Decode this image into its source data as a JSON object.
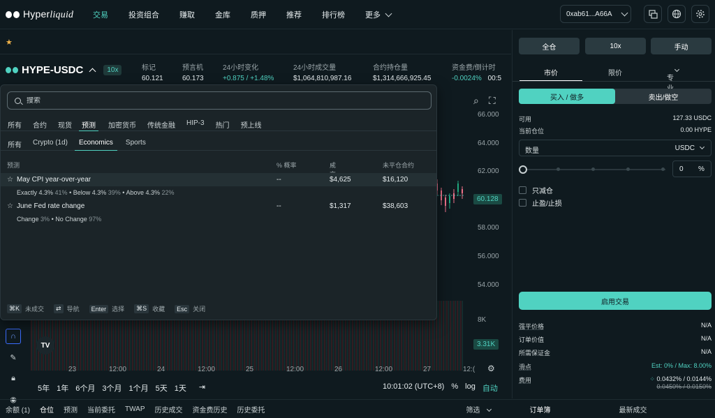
{
  "nav": {
    "brand": "Hyperliquid",
    "links": [
      "交易",
      "投资组合",
      "赚取",
      "金库",
      "质押",
      "推荐",
      "排行榜",
      "更多"
    ],
    "wallet": "0xab61...A66A"
  },
  "ticker": {
    "pair": "HYPE-USDC",
    "leverage": "10x",
    "stats": [
      {
        "label": "标记",
        "value": "60.121"
      },
      {
        "label": "预言机",
        "value": "60.173"
      },
      {
        "label": "24小时变化",
        "value": "+0.875 / +1.48%"
      },
      {
        "label": "24小时成交量",
        "value": "$1,064,810,987.16"
      },
      {
        "label": "合约持仓量",
        "value": "$1,314,666,925.45"
      },
      {
        "label": "资金费/倒计时",
        "value": "-0.0024%",
        "extra": "00:5"
      }
    ]
  },
  "chart": {
    "y_ticks": [
      "66.000",
      "64.000",
      "62.000",
      "60.128",
      "58.000",
      "56.000",
      "54.000",
      "8K",
      "3.31K"
    ],
    "x_ticks": [
      "23",
      "12:00",
      "24",
      "12:00",
      "25",
      "12:00",
      "26",
      "12:00",
      "27",
      "12:("
    ],
    "ranges": [
      "5年",
      "1年",
      "6个月",
      "3个月",
      "1个月",
      "5天",
      "1天"
    ],
    "time": "10:01:02 (UTC+8)",
    "pct": "%",
    "log": "log",
    "auto": "自动",
    "current_price": "60.128",
    "current_vol": "3.31K"
  },
  "dropdown": {
    "search_placeholder": "搜索",
    "tabs": [
      "所有",
      "合约",
      "现货",
      "预测",
      "加密货币",
      "传统金融",
      "HIP-3",
      "热门",
      "预上线"
    ],
    "subtabs": [
      "所有",
      "Crypto (1d)",
      "Economics",
      "Sports"
    ],
    "columns": {
      "name": "预测",
      "prob": "% 概率",
      "volume": "成交量",
      "oi": "未平仓合约"
    },
    "rows": [
      {
        "title": "May CPI year-over-year",
        "prob": "--",
        "volume": "$4,625",
        "oi": "$16,120",
        "outcomes": [
          {
            "label": "Exactly 4.3%",
            "pct": "41%"
          },
          {
            "label": "Below 4.3%",
            "pct": "39%"
          },
          {
            "label": "Above 4.3%",
            "pct": "22%"
          }
        ]
      },
      {
        "title": "June Fed rate change",
        "prob": "--",
        "volume": "$1,317",
        "oi": "$38,603",
        "outcomes": [
          {
            "label": "Change",
            "pct": "3%"
          },
          {
            "label": "No Change",
            "pct": "97%"
          }
        ]
      }
    ],
    "shortcuts": [
      {
        "key": "⌘K",
        "label": "未成交"
      },
      {
        "key": "⇄",
        "label": "导航"
      },
      {
        "key": "Enter",
        "label": "选择"
      },
      {
        "key": "⌘S",
        "label": "收藏"
      },
      {
        "key": "Esc",
        "label": "关闭"
      }
    ]
  },
  "order": {
    "margin_mode": "全仓",
    "leverage": "10x",
    "manual": "手动",
    "type_tabs": [
      "市价",
      "限价",
      "专业"
    ],
    "buy": "买入 / 做多",
    "sell": "卖出/做空",
    "available_label": "可用",
    "available_value": "127.33 USDC",
    "position_label": "当前仓位",
    "position_value": "0.00 HYPE",
    "qty_label": "数量",
    "qty_unit": "USDC",
    "pct_value": "0",
    "pct_sign": "%",
    "reduce_only": "只减仓",
    "tpsl": "止盈/止损",
    "enable": "启用交易",
    "info": [
      {
        "label": "强平价格",
        "value": "N/A"
      },
      {
        "label": "订单价值",
        "value": "N/A"
      },
      {
        "label": "所需保证金",
        "value": "N/A"
      },
      {
        "label": "滑点",
        "value": "Est: 0% / Max: 8.00%"
      },
      {
        "label": "费用",
        "value": "0.0432% / 0.0144%",
        "old": "0.0450% / 0.0150%"
      }
    ],
    "book_tabs": [
      "订单簿",
      "最新成交"
    ]
  },
  "bottom": {
    "tabs": [
      "余额 (1)",
      "仓位",
      "预测",
      "当前委托",
      "TWAP",
      "历史成交",
      "资金费历史",
      "历史委托"
    ],
    "filter": "筛选"
  }
}
